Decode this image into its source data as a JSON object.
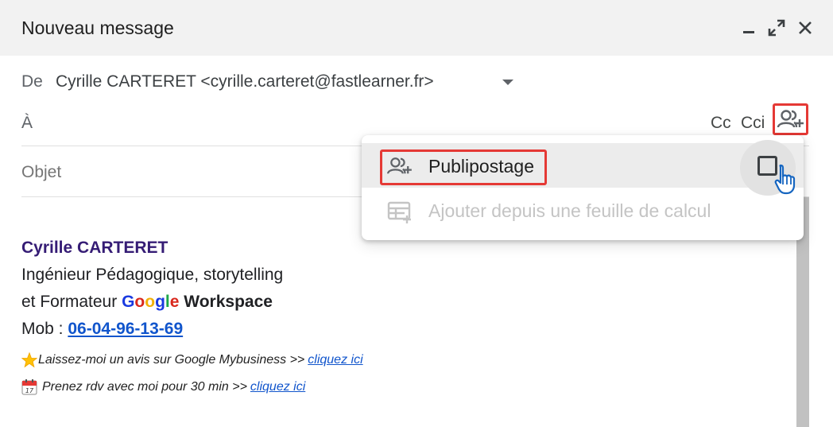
{
  "window": {
    "title": "Nouveau message",
    "minimize_icon": "minimize-icon",
    "expand_icon": "expand-icon",
    "close_icon": "close-icon"
  },
  "from": {
    "label": "De",
    "value": "Cyrille CARTERET <cyrille.carteret@fastlearner.fr>"
  },
  "to": {
    "label": "À",
    "cc_label": "Cc",
    "cci_label": "Cci",
    "recipients_icon": "add-people-icon"
  },
  "subject": {
    "placeholder": "Objet",
    "value": ""
  },
  "signature": {
    "name": "Cyrille CARTERET",
    "role_line": "Ingénieur Pédagogique, storytelling",
    "trainer_prefix": "et Formateur",
    "google_letters": [
      "G",
      "o",
      "o",
      "g",
      "l",
      "e"
    ],
    "workspace": "Workspace",
    "mob_label": "Mob :",
    "phone": "06-04-96-13-69",
    "review_text": "Laissez-moi un avis sur Google Mybusiness >>",
    "review_link": "cliquez ici",
    "rdv_text": "Prenez rdv avec moi pour 30 min >>",
    "rdv_link": "cliquez ici",
    "star_icon": "star-icon",
    "calendar_icon": "calendar-icon"
  },
  "menu": {
    "mail_merge_label": "Publipostage",
    "mail_merge_checked": false,
    "add_from_sheet_label": "Ajouter depuis une feuille de calcul",
    "add_from_sheet_enabled": false
  },
  "colors": {
    "highlight_red": "#e53935",
    "signature_name": "#351c75",
    "link": "#1155cc",
    "google_blue": "#1a3ae0",
    "google_red": "#d9281d",
    "google_yellow": "#f2b10a",
    "google_green": "#1ea84a"
  }
}
